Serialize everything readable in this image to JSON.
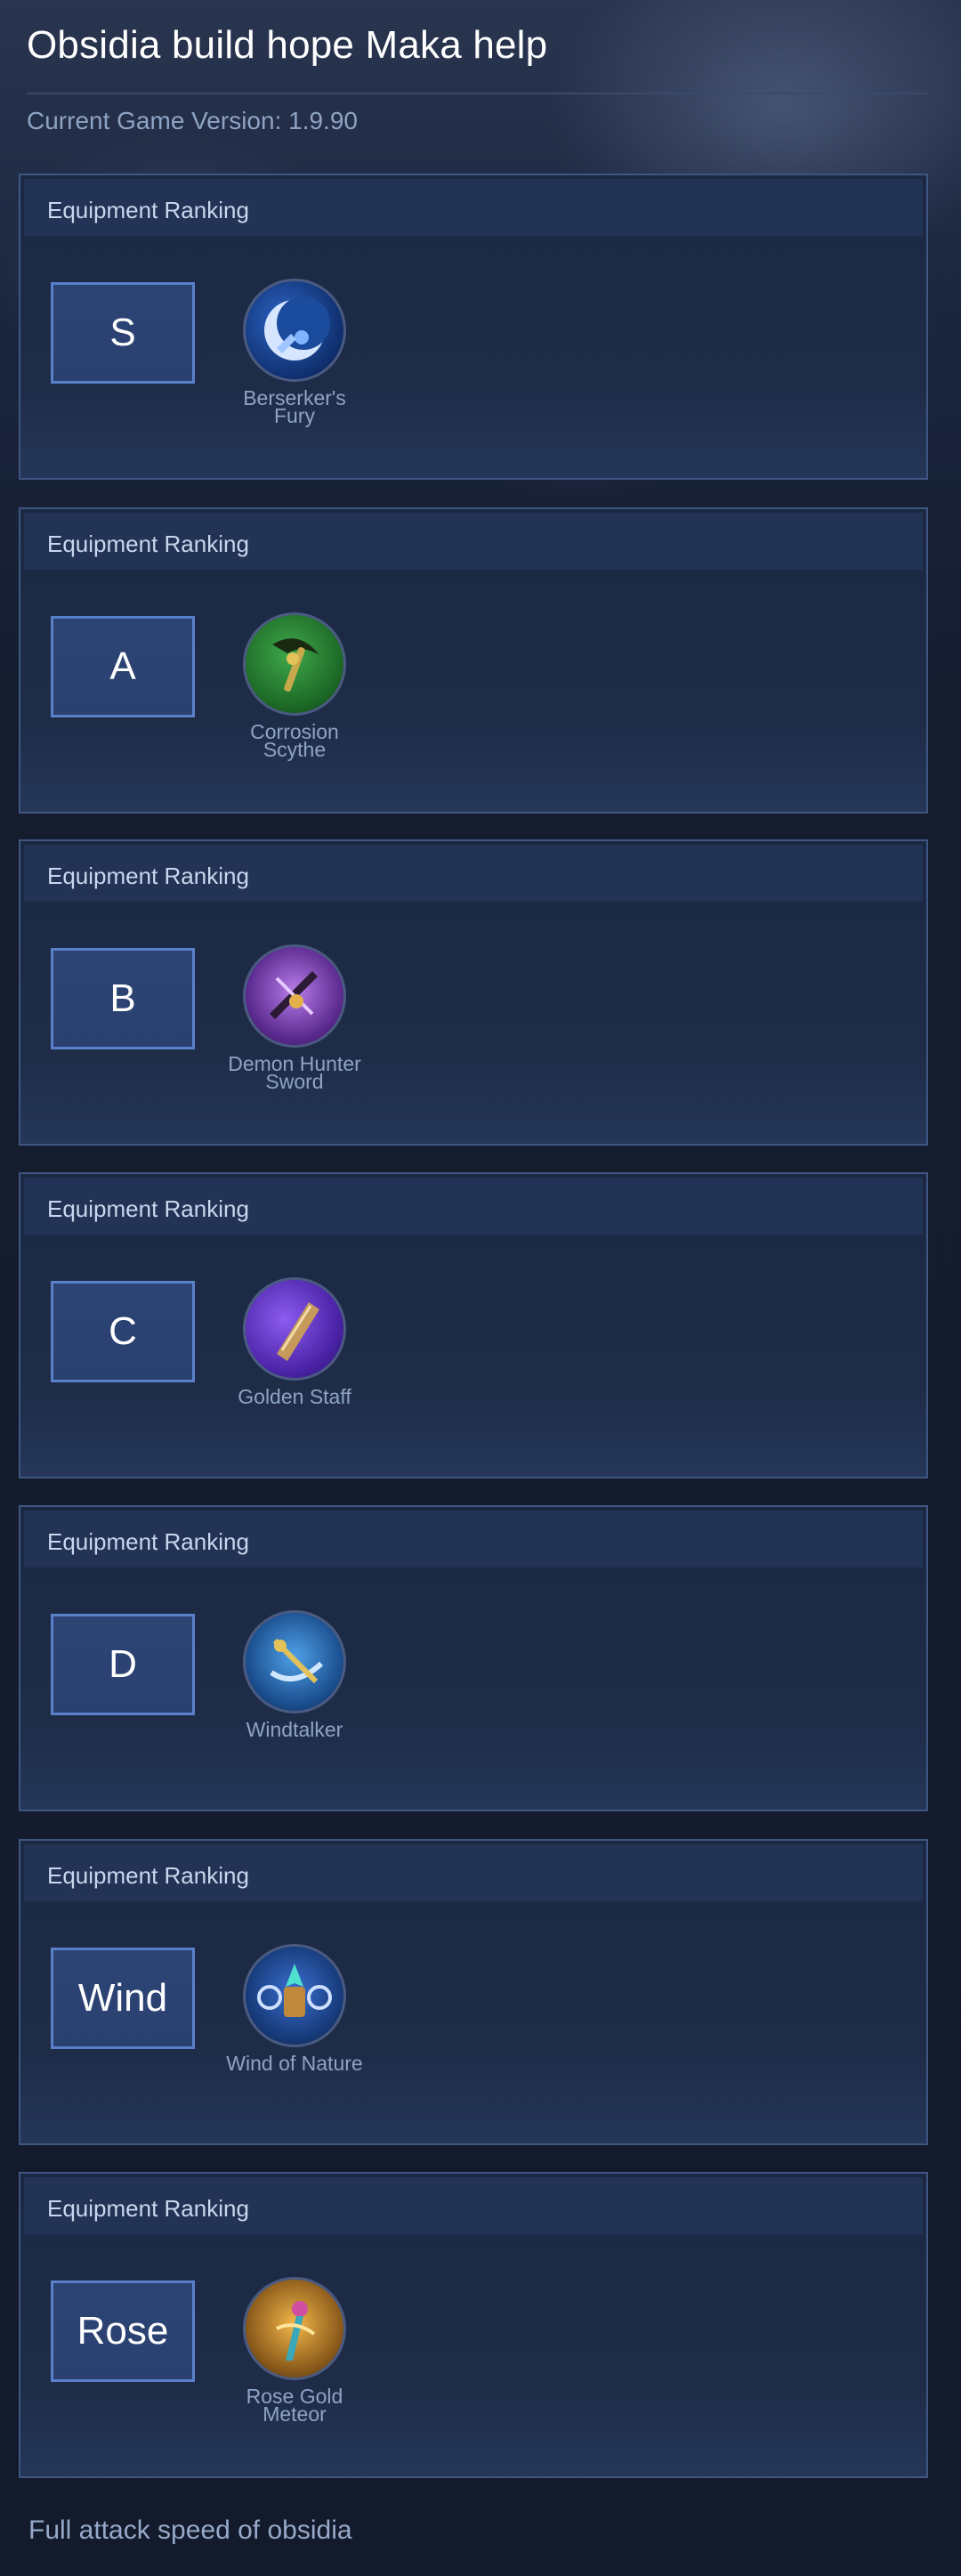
{
  "page": {
    "title": "Obsidia build hope Maka help",
    "version": "Current Game Version: 1.9.90",
    "footer": "Full attack speed of obsidia"
  },
  "sections": [
    {
      "header": "Equipment Ranking",
      "tier": "S",
      "item": {
        "name": "Berserker's Fury",
        "icon": "crescent-moon-icon"
      }
    },
    {
      "header": "Equipment Ranking",
      "tier": "A",
      "item": {
        "name": "Corrosion Scythe",
        "icon": "scythe-icon"
      }
    },
    {
      "header": "Equipment Ranking",
      "tier": "B",
      "item": {
        "name": "Demon Hunter Sword",
        "icon": "sword-icon"
      }
    },
    {
      "header": "Equipment Ranking",
      "tier": "C",
      "item": {
        "name": "Golden Staff",
        "icon": "staff-icon"
      }
    },
    {
      "header": "Equipment Ranking",
      "tier": "D",
      "item": {
        "name": "Windtalker",
        "icon": "windtalker-icon"
      }
    },
    {
      "header": "Equipment Ranking",
      "tier": "Wind",
      "item": {
        "name": "Wind of Nature",
        "icon": "wind-of-nature-icon"
      }
    },
    {
      "header": "Equipment Ranking",
      "tier": "Rose",
      "item": {
        "name": "Rose Gold Meteor",
        "icon": "meteor-icon"
      }
    }
  ],
  "colors": {
    "accent_border": "#5a80c9",
    "panel_border": "#3f5682",
    "header_bg": "#223355"
  }
}
